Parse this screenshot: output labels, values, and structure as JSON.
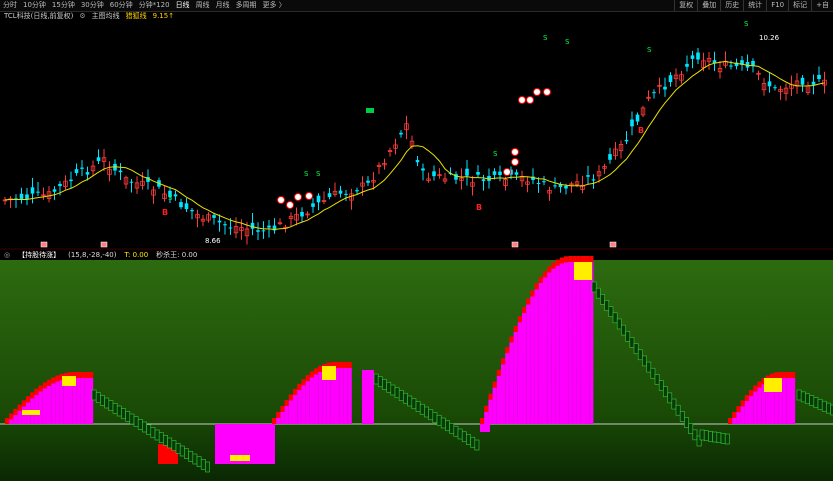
{
  "toolbar": {
    "items": [
      "分时",
      "10分钟",
      "15分钟",
      "30分钟",
      "60分钟",
      "分钟*120",
      "日线",
      "周线",
      "月线",
      "多周期",
      "更多 〉"
    ],
    "active_index": 6,
    "right_items": [
      "复权",
      "叠加",
      "历史",
      "统计",
      "F10",
      "标记",
      "+自"
    ]
  },
  "infobar": {
    "stock_name": "TCL科技(日线,前复权)",
    "ma_label": "主图均线",
    "ind_name": "猎狐线",
    "ind_value": "9.15↑"
  },
  "indicator_bar": {
    "title": "【持股待涨】",
    "params": "(15,8,-28,-40)",
    "t_label": "T: 0.00",
    "second_label": "秒杀王: 0.00"
  },
  "colors": {
    "up": "#ff3c3c",
    "down": "#00e5ff",
    "ma": "#e8e000",
    "top_bg": "#2d6b10",
    "pink": "#ff00ff",
    "red": "#ff0000",
    "yellow": "#ffee00",
    "green_box": "#0a3a0a"
  },
  "annotations": {
    "high_price": "10.26",
    "low_price": "8.66",
    "buy_marker": "B",
    "sell_marker": "S"
  }
}
